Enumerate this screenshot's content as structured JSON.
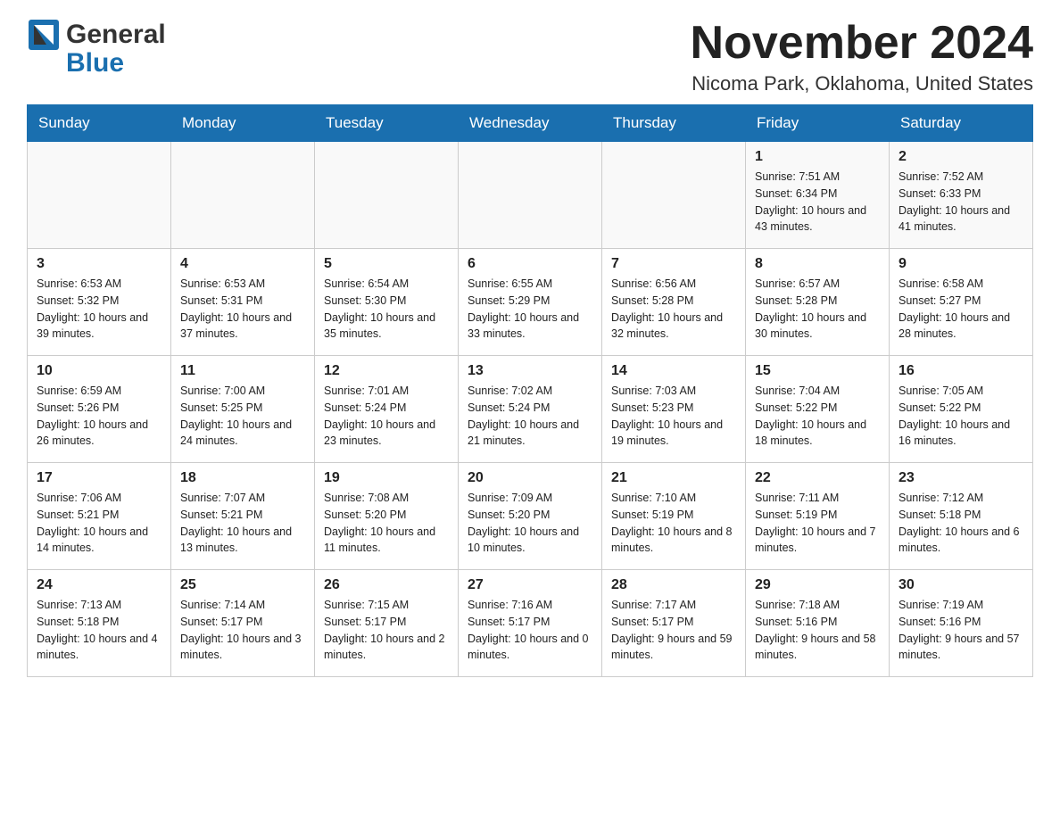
{
  "header": {
    "logo_general": "General",
    "logo_blue": "Blue",
    "month": "November 2024",
    "location": "Nicoma Park, Oklahoma, United States"
  },
  "days_of_week": [
    "Sunday",
    "Monday",
    "Tuesday",
    "Wednesday",
    "Thursday",
    "Friday",
    "Saturday"
  ],
  "weeks": [
    [
      {
        "day": "",
        "info": ""
      },
      {
        "day": "",
        "info": ""
      },
      {
        "day": "",
        "info": ""
      },
      {
        "day": "",
        "info": ""
      },
      {
        "day": "",
        "info": ""
      },
      {
        "day": "1",
        "info": "Sunrise: 7:51 AM\nSunset: 6:34 PM\nDaylight: 10 hours and 43 minutes."
      },
      {
        "day": "2",
        "info": "Sunrise: 7:52 AM\nSunset: 6:33 PM\nDaylight: 10 hours and 41 minutes."
      }
    ],
    [
      {
        "day": "3",
        "info": "Sunrise: 6:53 AM\nSunset: 5:32 PM\nDaylight: 10 hours and 39 minutes."
      },
      {
        "day": "4",
        "info": "Sunrise: 6:53 AM\nSunset: 5:31 PM\nDaylight: 10 hours and 37 minutes."
      },
      {
        "day": "5",
        "info": "Sunrise: 6:54 AM\nSunset: 5:30 PM\nDaylight: 10 hours and 35 minutes."
      },
      {
        "day": "6",
        "info": "Sunrise: 6:55 AM\nSunset: 5:29 PM\nDaylight: 10 hours and 33 minutes."
      },
      {
        "day": "7",
        "info": "Sunrise: 6:56 AM\nSunset: 5:28 PM\nDaylight: 10 hours and 32 minutes."
      },
      {
        "day": "8",
        "info": "Sunrise: 6:57 AM\nSunset: 5:28 PM\nDaylight: 10 hours and 30 minutes."
      },
      {
        "day": "9",
        "info": "Sunrise: 6:58 AM\nSunset: 5:27 PM\nDaylight: 10 hours and 28 minutes."
      }
    ],
    [
      {
        "day": "10",
        "info": "Sunrise: 6:59 AM\nSunset: 5:26 PM\nDaylight: 10 hours and 26 minutes."
      },
      {
        "day": "11",
        "info": "Sunrise: 7:00 AM\nSunset: 5:25 PM\nDaylight: 10 hours and 24 minutes."
      },
      {
        "day": "12",
        "info": "Sunrise: 7:01 AM\nSunset: 5:24 PM\nDaylight: 10 hours and 23 minutes."
      },
      {
        "day": "13",
        "info": "Sunrise: 7:02 AM\nSunset: 5:24 PM\nDaylight: 10 hours and 21 minutes."
      },
      {
        "day": "14",
        "info": "Sunrise: 7:03 AM\nSunset: 5:23 PM\nDaylight: 10 hours and 19 minutes."
      },
      {
        "day": "15",
        "info": "Sunrise: 7:04 AM\nSunset: 5:22 PM\nDaylight: 10 hours and 18 minutes."
      },
      {
        "day": "16",
        "info": "Sunrise: 7:05 AM\nSunset: 5:22 PM\nDaylight: 10 hours and 16 minutes."
      }
    ],
    [
      {
        "day": "17",
        "info": "Sunrise: 7:06 AM\nSunset: 5:21 PM\nDaylight: 10 hours and 14 minutes."
      },
      {
        "day": "18",
        "info": "Sunrise: 7:07 AM\nSunset: 5:21 PM\nDaylight: 10 hours and 13 minutes."
      },
      {
        "day": "19",
        "info": "Sunrise: 7:08 AM\nSunset: 5:20 PM\nDaylight: 10 hours and 11 minutes."
      },
      {
        "day": "20",
        "info": "Sunrise: 7:09 AM\nSunset: 5:20 PM\nDaylight: 10 hours and 10 minutes."
      },
      {
        "day": "21",
        "info": "Sunrise: 7:10 AM\nSunset: 5:19 PM\nDaylight: 10 hours and 8 minutes."
      },
      {
        "day": "22",
        "info": "Sunrise: 7:11 AM\nSunset: 5:19 PM\nDaylight: 10 hours and 7 minutes."
      },
      {
        "day": "23",
        "info": "Sunrise: 7:12 AM\nSunset: 5:18 PM\nDaylight: 10 hours and 6 minutes."
      }
    ],
    [
      {
        "day": "24",
        "info": "Sunrise: 7:13 AM\nSunset: 5:18 PM\nDaylight: 10 hours and 4 minutes."
      },
      {
        "day": "25",
        "info": "Sunrise: 7:14 AM\nSunset: 5:17 PM\nDaylight: 10 hours and 3 minutes."
      },
      {
        "day": "26",
        "info": "Sunrise: 7:15 AM\nSunset: 5:17 PM\nDaylight: 10 hours and 2 minutes."
      },
      {
        "day": "27",
        "info": "Sunrise: 7:16 AM\nSunset: 5:17 PM\nDaylight: 10 hours and 0 minutes."
      },
      {
        "day": "28",
        "info": "Sunrise: 7:17 AM\nSunset: 5:17 PM\nDaylight: 9 hours and 59 minutes."
      },
      {
        "day": "29",
        "info": "Sunrise: 7:18 AM\nSunset: 5:16 PM\nDaylight: 9 hours and 58 minutes."
      },
      {
        "day": "30",
        "info": "Sunrise: 7:19 AM\nSunset: 5:16 PM\nDaylight: 9 hours and 57 minutes."
      }
    ]
  ]
}
